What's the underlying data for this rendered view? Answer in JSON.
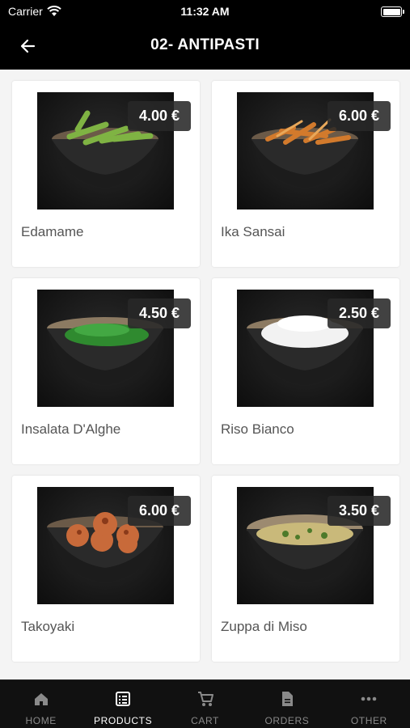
{
  "status_bar": {
    "carrier": "Carrier",
    "time": "11:32 AM"
  },
  "header": {
    "title": "02- ANTIPASTI"
  },
  "products": [
    {
      "name": "Edamame",
      "price": "4.00 €"
    },
    {
      "name": "Ika Sansai",
      "price": "6.00 €"
    },
    {
      "name": "Insalata D'Alghe",
      "price": "4.50 €"
    },
    {
      "name": "Riso Bianco",
      "price": "2.50 €"
    },
    {
      "name": "Takoyaki",
      "price": "6.00 €"
    },
    {
      "name": "Zuppa di Miso",
      "price": "3.50 €"
    }
  ],
  "tabs": [
    {
      "label": "HOME",
      "icon": "home-icon"
    },
    {
      "label": "PRODUCTS",
      "icon": "products-icon",
      "active": true
    },
    {
      "label": "CART",
      "icon": "cart-icon"
    },
    {
      "label": "ORDERS",
      "icon": "orders-icon"
    },
    {
      "label": "OTHER",
      "icon": "more-icon"
    }
  ]
}
